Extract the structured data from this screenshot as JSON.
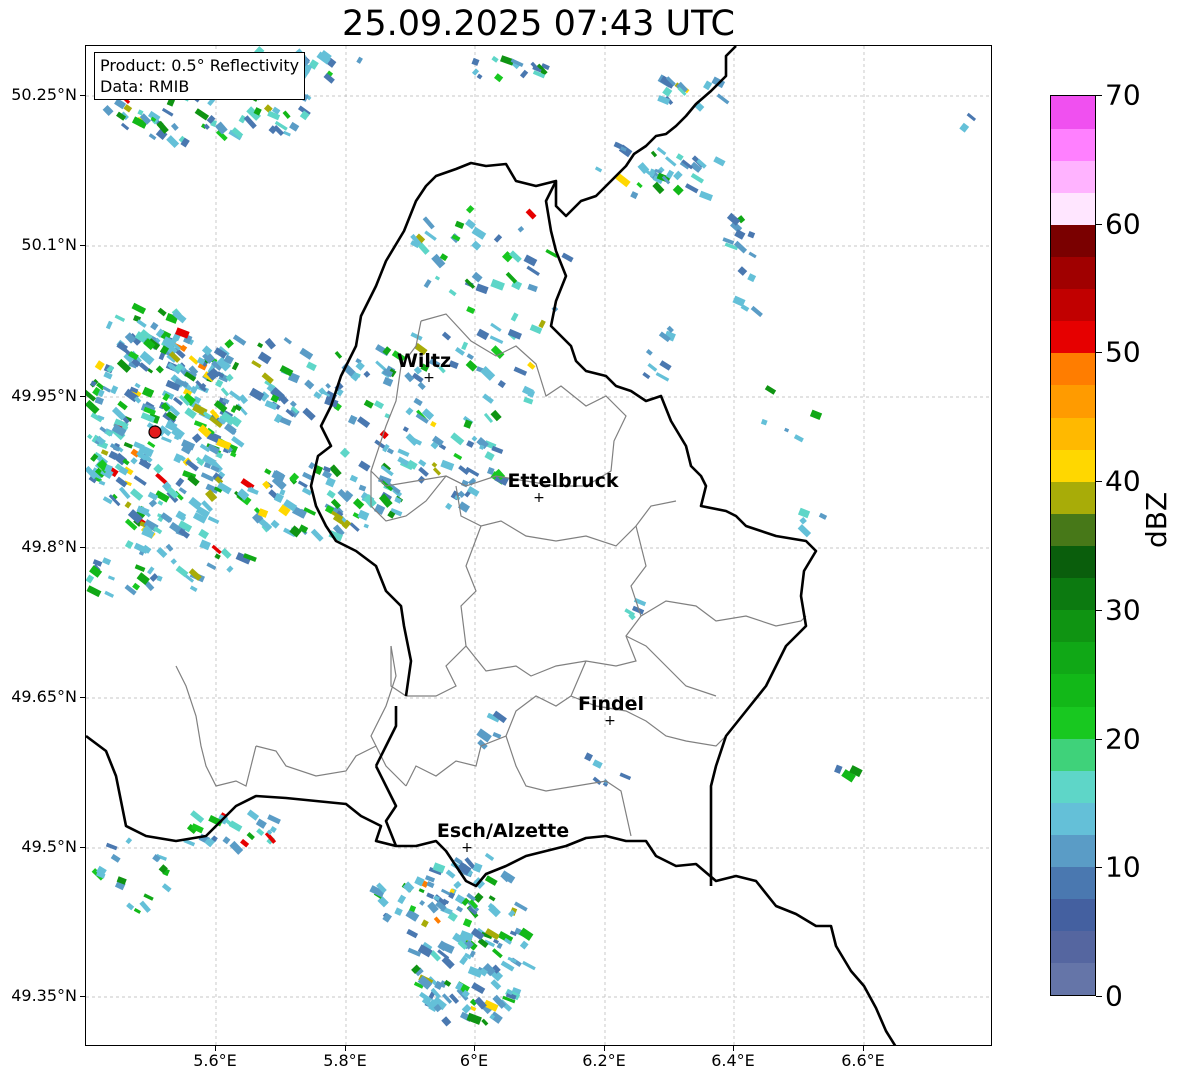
{
  "title": "25.09.2025 07:43 UTC",
  "info_box": {
    "product": "Product: 0.5° Reflectivity",
    "data": "Data: RMIB"
  },
  "axes": {
    "lat_ticks": [
      "50.25°N",
      "50.1°N",
      "49.95°N",
      "49.8°N",
      "49.65°N",
      "49.5°N",
      "49.35°N"
    ],
    "lon_ticks": [
      "5.6°E",
      "5.8°E",
      "6°E",
      "6.2°E",
      "6.4°E",
      "6.6°E"
    ]
  },
  "cities": [
    {
      "name": "Wiltz",
      "marker": "+"
    },
    {
      "name": "Ettelbruck",
      "marker": "+"
    },
    {
      "name": "Findel",
      "marker": "+"
    },
    {
      "name": "Esch/Alzette",
      "marker": "+"
    }
  ],
  "radar_site": {
    "color": "#e41a1c",
    "icon": "radar-site-marker"
  },
  "colorbar": {
    "unit": "dBZ",
    "min": 0,
    "max": 70,
    "tick_labels": [
      "0",
      "10",
      "20",
      "30",
      "40",
      "50",
      "60",
      "70"
    ],
    "colors": [
      "#6575a8",
      "#5566a0",
      "#4460a0",
      "#4a78b0",
      "#5a9cc6",
      "#64c0d8",
      "#5ed6c8",
      "#3fd27a",
      "#18c820",
      "#12b818",
      "#10a816",
      "#0f9412",
      "#0c7a10",
      "#0a5e0c",
      "#477818",
      "#a8ac08",
      "#ffd700",
      "#ffb900",
      "#ff9b00",
      "#ff7d00",
      "#e60000",
      "#c10000",
      "#a00000",
      "#7a0000",
      "#ffe6ff",
      "#ffb3ff",
      "#ff80ff",
      "#f050f0"
    ]
  }
}
